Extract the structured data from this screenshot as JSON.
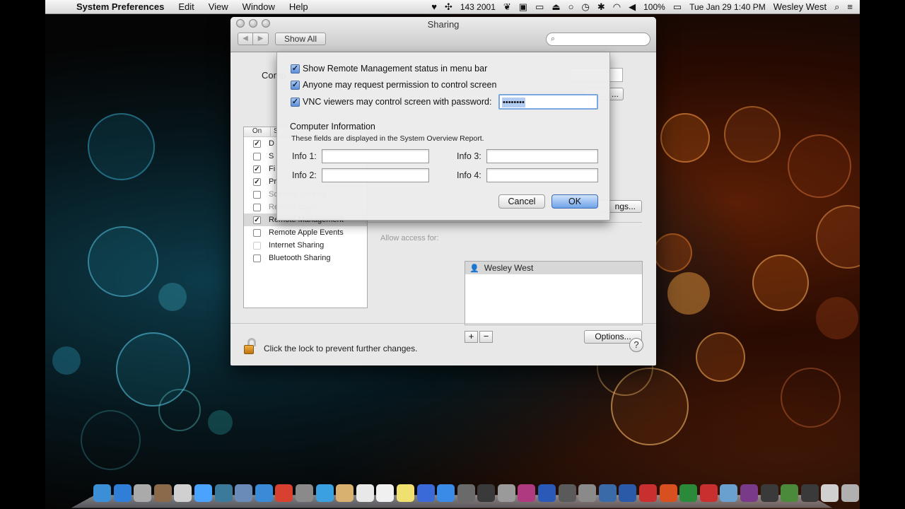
{
  "menubar": {
    "apple_icon": "apple-icon",
    "items": [
      "System Preferences",
      "Edit",
      "View",
      "Window",
      "Help"
    ],
    "status": {
      "counter": "143 2001",
      "battery": "100%",
      "datetime": "Tue Jan 29  1:40 PM",
      "user": "Wesley West"
    }
  },
  "window": {
    "title": "Sharing",
    "show_all": "Show All",
    "search_placeholder": "",
    "computer_name_label": "Comp",
    "edit_button": "...",
    "services_header": {
      "on": "On",
      "service": "S"
    },
    "services": [
      {
        "label": "D",
        "checked": true,
        "enabled": true
      },
      {
        "label": "S",
        "checked": false,
        "enabled": true
      },
      {
        "label": "Fi",
        "checked": true,
        "enabled": true
      },
      {
        "label": "Pr",
        "checked": true,
        "enabled": true
      },
      {
        "label": "Scanner Sharing",
        "checked": false,
        "enabled": true,
        "dim": true
      },
      {
        "label": "Remote Login",
        "checked": false,
        "enabled": true,
        "dim": true
      },
      {
        "label": "Remote Management",
        "checked": true,
        "enabled": true,
        "selected": true
      },
      {
        "label": "Remote Apple Events",
        "checked": false,
        "enabled": true
      },
      {
        "label": "Internet Sharing",
        "checked": false,
        "enabled": false
      },
      {
        "label": "Bluetooth Sharing",
        "checked": false,
        "enabled": true
      }
    ],
    "settings_button": "ngs...",
    "allow_access_label": "Allow access for:",
    "users": [
      "Wesley West"
    ],
    "options_button": "Options...",
    "lock_text": "Click the lock to prevent further changes.",
    "help": "?"
  },
  "sheet": {
    "show_status": "Show Remote Management status in menu bar",
    "anyone_request": "Anyone may request permission to control screen",
    "vnc_label": "VNC viewers may control screen with password:",
    "vnc_password": "••••••••",
    "ci_title": "Computer Information",
    "ci_sub": "These fields are displayed in the System Overview Report.",
    "info1": "Info 1:",
    "info2": "Info 2:",
    "info3": "Info 3:",
    "info4": "Info 4:",
    "cancel": "Cancel",
    "ok": "OK"
  },
  "dock": {
    "icons": [
      "finder",
      "dropbox",
      "launchpad",
      "photo-booth",
      "iphone-config",
      "messages",
      "network",
      "preview",
      "safari",
      "chrome",
      "automator",
      "twitter",
      "notes",
      "calendar",
      "textedit",
      "stickies",
      "itunes",
      "app-store",
      "photo",
      "camera",
      "scanner",
      "game",
      "photoshop",
      "aperture",
      "remote",
      "xcode",
      "word",
      "acrobat",
      "powerpoint",
      "excel",
      "parallels",
      "transmit",
      "rar",
      "dashboard",
      "activity",
      "terminal",
      "downloads",
      "trash"
    ]
  }
}
